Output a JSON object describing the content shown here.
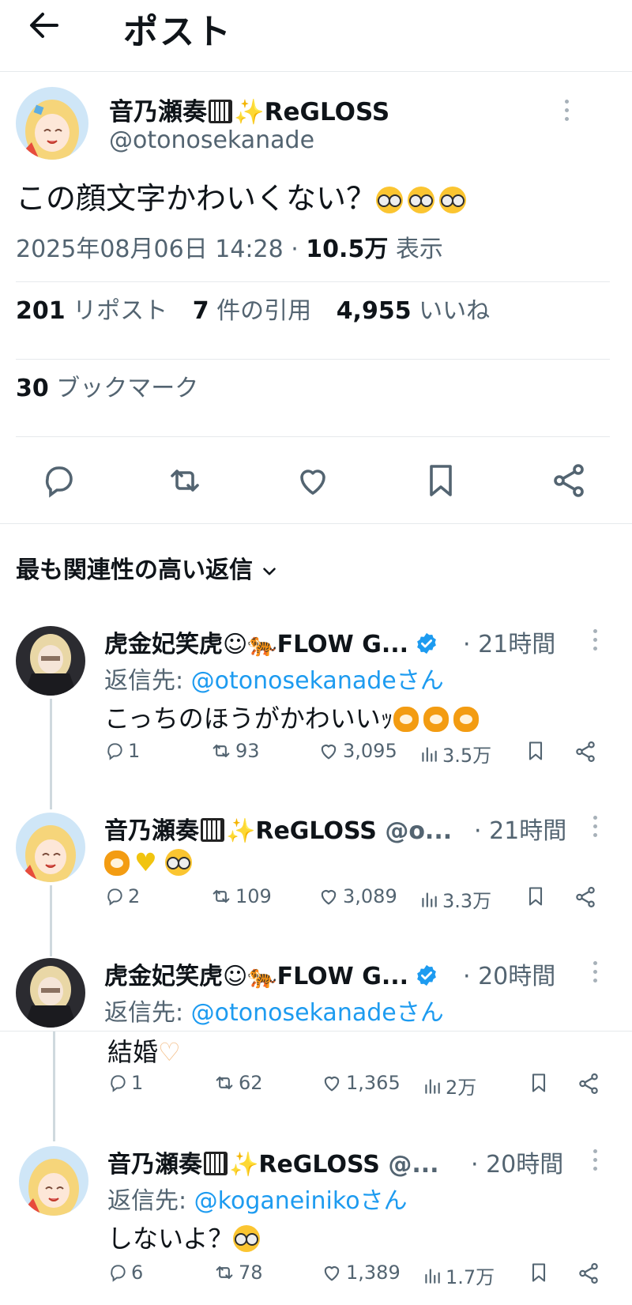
{
  "header": {
    "title": "ポスト"
  },
  "post": {
    "author_name": "音乃瀬奏",
    "author_suffix": "ReGLOSS",
    "handle": "@otonosekanade",
    "text": "この顔文字かわいくない？",
    "datetime": "2025年08月06日 14:28",
    "views": "10.5万",
    "views_label": "表示",
    "reposts": "201",
    "reposts_label": "リポスト",
    "quotes": "7",
    "quotes_label": "件の引用",
    "likes": "4,955",
    "likes_label": "いいね",
    "bookmarks": "30",
    "bookmarks_label": "ブックマーク"
  },
  "sort_label": "最も関連性の高い返信",
  "replies": [
    {
      "name": "虎金妃笑虎",
      "name_suffix": "FLOW G...",
      "time": "· 21時間",
      "reply_to_prefix": "返信先: ",
      "reply_to": "@otonosekanadeさん",
      "text": "こっちのほうがかわいいｯ",
      "replies": "1",
      "reposts": "93",
      "likes": "3,095",
      "views": "3.5万"
    },
    {
      "name": "音乃瀬奏",
      "name_suffix": "ReGLOSS",
      "handle": "@o...",
      "time": "· 21時間",
      "text": "",
      "replies": "2",
      "reposts": "109",
      "likes": "3,089",
      "views": "3.3万"
    },
    {
      "name": "虎金妃笑虎",
      "name_suffix": "FLOW G...",
      "time": "· 20時間",
      "reply_to_prefix": "返信先: ",
      "reply_to": "@otonosekanadeさん",
      "text": "結婚",
      "replies": "1",
      "reposts": "62",
      "likes": "1,365",
      "views": "2万"
    },
    {
      "name": "音乃瀬奏",
      "name_suffix": "ReGLOSS",
      "handle": "@...",
      "time": "· 20時間",
      "reply_to_prefix": "返信先: ",
      "reply_to": "@koganeinikoさん",
      "text": "しないよ？",
      "replies": "6",
      "reposts": "78",
      "likes": "1,389",
      "views": "1.7万"
    }
  ],
  "colors": {
    "link": "#1d9bf0",
    "secondary": "#536471",
    "divider": "#e6e9ec",
    "verified": "#1d9bf0"
  }
}
